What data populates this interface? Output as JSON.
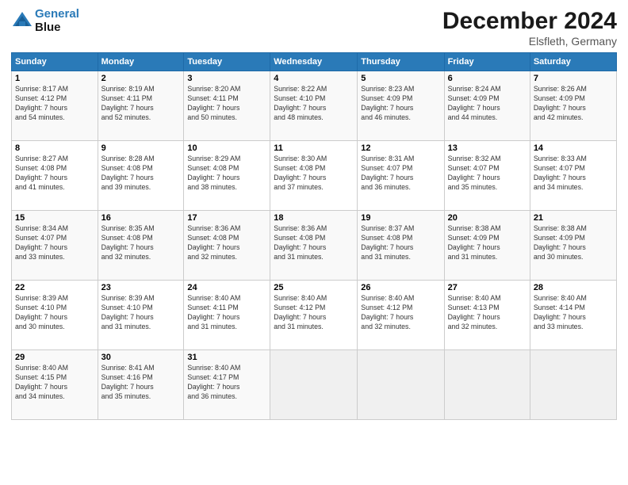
{
  "header": {
    "logo_line1": "General",
    "logo_line2": "Blue",
    "month_title": "December 2024",
    "location": "Elsfleth, Germany"
  },
  "days_of_week": [
    "Sunday",
    "Monday",
    "Tuesday",
    "Wednesday",
    "Thursday",
    "Friday",
    "Saturday"
  ],
  "weeks": [
    [
      {
        "day": "1",
        "info": "Sunrise: 8:17 AM\nSunset: 4:12 PM\nDaylight: 7 hours\nand 54 minutes."
      },
      {
        "day": "2",
        "info": "Sunrise: 8:19 AM\nSunset: 4:11 PM\nDaylight: 7 hours\nand 52 minutes."
      },
      {
        "day": "3",
        "info": "Sunrise: 8:20 AM\nSunset: 4:11 PM\nDaylight: 7 hours\nand 50 minutes."
      },
      {
        "day": "4",
        "info": "Sunrise: 8:22 AM\nSunset: 4:10 PM\nDaylight: 7 hours\nand 48 minutes."
      },
      {
        "day": "5",
        "info": "Sunrise: 8:23 AM\nSunset: 4:09 PM\nDaylight: 7 hours\nand 46 minutes."
      },
      {
        "day": "6",
        "info": "Sunrise: 8:24 AM\nSunset: 4:09 PM\nDaylight: 7 hours\nand 44 minutes."
      },
      {
        "day": "7",
        "info": "Sunrise: 8:26 AM\nSunset: 4:09 PM\nDaylight: 7 hours\nand 42 minutes."
      }
    ],
    [
      {
        "day": "8",
        "info": "Sunrise: 8:27 AM\nSunset: 4:08 PM\nDaylight: 7 hours\nand 41 minutes."
      },
      {
        "day": "9",
        "info": "Sunrise: 8:28 AM\nSunset: 4:08 PM\nDaylight: 7 hours\nand 39 minutes."
      },
      {
        "day": "10",
        "info": "Sunrise: 8:29 AM\nSunset: 4:08 PM\nDaylight: 7 hours\nand 38 minutes."
      },
      {
        "day": "11",
        "info": "Sunrise: 8:30 AM\nSunset: 4:08 PM\nDaylight: 7 hours\nand 37 minutes."
      },
      {
        "day": "12",
        "info": "Sunrise: 8:31 AM\nSunset: 4:07 PM\nDaylight: 7 hours\nand 36 minutes."
      },
      {
        "day": "13",
        "info": "Sunrise: 8:32 AM\nSunset: 4:07 PM\nDaylight: 7 hours\nand 35 minutes."
      },
      {
        "day": "14",
        "info": "Sunrise: 8:33 AM\nSunset: 4:07 PM\nDaylight: 7 hours\nand 34 minutes."
      }
    ],
    [
      {
        "day": "15",
        "info": "Sunrise: 8:34 AM\nSunset: 4:07 PM\nDaylight: 7 hours\nand 33 minutes."
      },
      {
        "day": "16",
        "info": "Sunrise: 8:35 AM\nSunset: 4:08 PM\nDaylight: 7 hours\nand 32 minutes."
      },
      {
        "day": "17",
        "info": "Sunrise: 8:36 AM\nSunset: 4:08 PM\nDaylight: 7 hours\nand 32 minutes."
      },
      {
        "day": "18",
        "info": "Sunrise: 8:36 AM\nSunset: 4:08 PM\nDaylight: 7 hours\nand 31 minutes."
      },
      {
        "day": "19",
        "info": "Sunrise: 8:37 AM\nSunset: 4:08 PM\nDaylight: 7 hours\nand 31 minutes."
      },
      {
        "day": "20",
        "info": "Sunrise: 8:38 AM\nSunset: 4:09 PM\nDaylight: 7 hours\nand 31 minutes."
      },
      {
        "day": "21",
        "info": "Sunrise: 8:38 AM\nSunset: 4:09 PM\nDaylight: 7 hours\nand 30 minutes."
      }
    ],
    [
      {
        "day": "22",
        "info": "Sunrise: 8:39 AM\nSunset: 4:10 PM\nDaylight: 7 hours\nand 30 minutes."
      },
      {
        "day": "23",
        "info": "Sunrise: 8:39 AM\nSunset: 4:10 PM\nDaylight: 7 hours\nand 31 minutes."
      },
      {
        "day": "24",
        "info": "Sunrise: 8:40 AM\nSunset: 4:11 PM\nDaylight: 7 hours\nand 31 minutes."
      },
      {
        "day": "25",
        "info": "Sunrise: 8:40 AM\nSunset: 4:12 PM\nDaylight: 7 hours\nand 31 minutes."
      },
      {
        "day": "26",
        "info": "Sunrise: 8:40 AM\nSunset: 4:12 PM\nDaylight: 7 hours\nand 32 minutes."
      },
      {
        "day": "27",
        "info": "Sunrise: 8:40 AM\nSunset: 4:13 PM\nDaylight: 7 hours\nand 32 minutes."
      },
      {
        "day": "28",
        "info": "Sunrise: 8:40 AM\nSunset: 4:14 PM\nDaylight: 7 hours\nand 33 minutes."
      }
    ],
    [
      {
        "day": "29",
        "info": "Sunrise: 8:40 AM\nSunset: 4:15 PM\nDaylight: 7 hours\nand 34 minutes."
      },
      {
        "day": "30",
        "info": "Sunrise: 8:41 AM\nSunset: 4:16 PM\nDaylight: 7 hours\nand 35 minutes."
      },
      {
        "day": "31",
        "info": "Sunrise: 8:40 AM\nSunset: 4:17 PM\nDaylight: 7 hours\nand 36 minutes."
      },
      {
        "day": "",
        "info": ""
      },
      {
        "day": "",
        "info": ""
      },
      {
        "day": "",
        "info": ""
      },
      {
        "day": "",
        "info": ""
      }
    ]
  ]
}
